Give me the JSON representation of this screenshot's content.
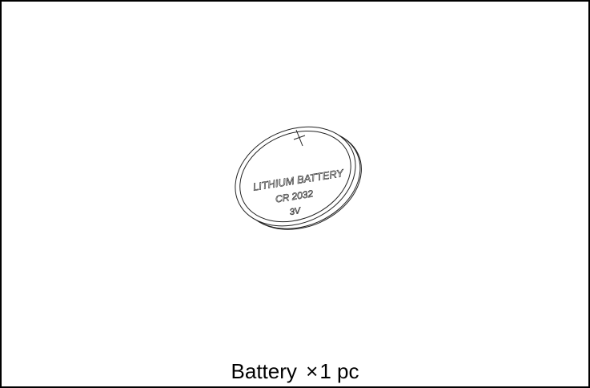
{
  "battery": {
    "line1": "LITHIUM BATTERY",
    "line2": "CR 2032",
    "line3": "3V",
    "symbol": "+"
  },
  "caption": {
    "name": "Battery",
    "multiply": "×",
    "quantity": "1 pc"
  },
  "colors": {
    "border": "#000000",
    "background": "#ffffff",
    "line": "#222222"
  }
}
